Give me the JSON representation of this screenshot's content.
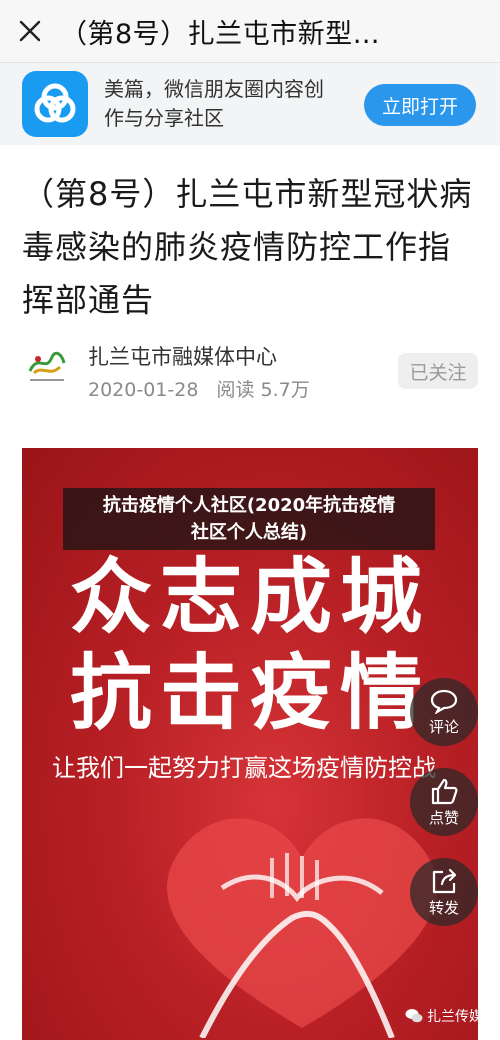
{
  "nav": {
    "title": "（第8号）扎兰屯市新型…"
  },
  "banner": {
    "app_line1": "美篇，微信朋友圈内容创",
    "app_line2": "作与分享社区",
    "open_label": "立即打开"
  },
  "article": {
    "title": "（第8号）扎兰屯市新型冠状病毒感染的肺炎疫情防控工作指挥部通告",
    "author": "扎兰屯市融媒体中心",
    "date": "2020-01-28",
    "reads": "阅读 5.7万",
    "follow_label": "已关注"
  },
  "poster": {
    "line1": "众志成城",
    "line2": "抗击疫情",
    "slogan": "让我们一起努力打赢这场疫情防控战"
  },
  "caption": {
    "line1": "抗击疫情个人社区(2020年抗击疫情",
    "line2": "社区个人总结)"
  },
  "actions": {
    "comment": "评论",
    "like": "点赞",
    "share": "转发"
  },
  "watermark": {
    "text": "扎兰传媒"
  },
  "colors": {
    "accent_blue": "#2a96ec",
    "poster_red": "#b82025"
  }
}
